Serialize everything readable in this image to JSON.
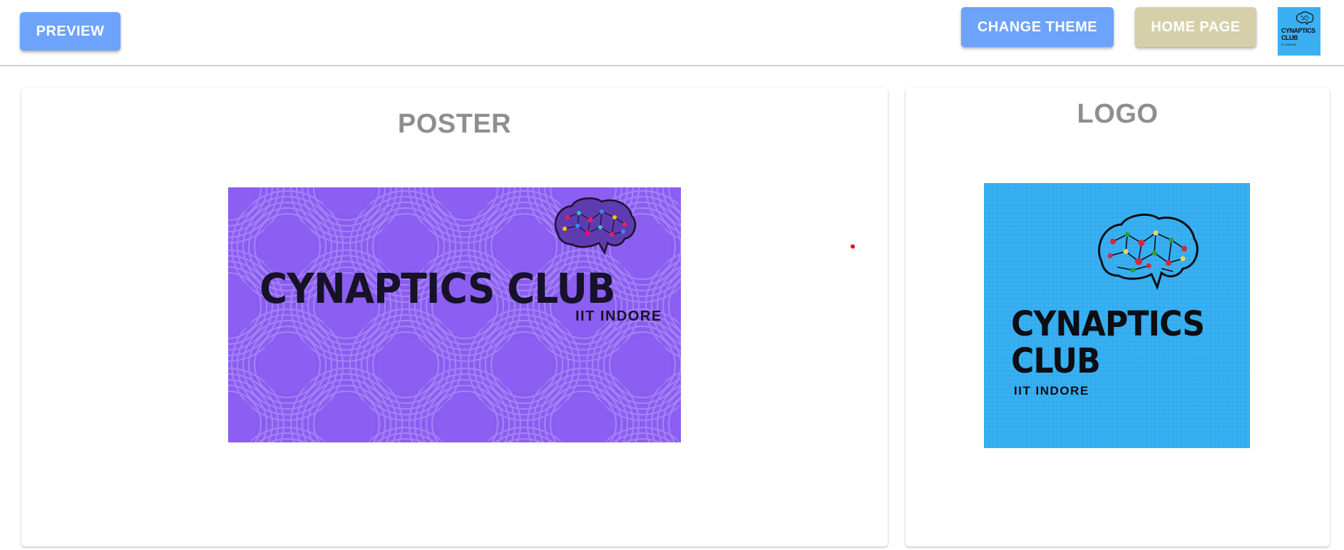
{
  "toolbar": {
    "preview_label": "PREVIEW",
    "change_theme_label": "CHANGE THEME",
    "home_page_label": "HOME PAGE"
  },
  "avatar": {
    "text": "CYNAPTICS CLUB",
    "subtext": "IIT INDORE"
  },
  "poster_card": {
    "title": "POSTER",
    "image": {
      "title": "CYNAPTICS CLUB",
      "subtitle": "IIT INDORE"
    }
  },
  "logo_card": {
    "title": "LOGO",
    "image": {
      "title_line1": "CYNAPTICS",
      "title_line2": "CLUB",
      "subtitle": "IIT INDORE"
    }
  },
  "colors": {
    "primary_button": "#6ea3fb",
    "home_button": "#d6d0aa",
    "poster_bg": "#8b5cf0",
    "logo_bg": "#37b1f4",
    "title_gray": "#8e8e8e"
  },
  "icons": [
    "brain-icon"
  ]
}
